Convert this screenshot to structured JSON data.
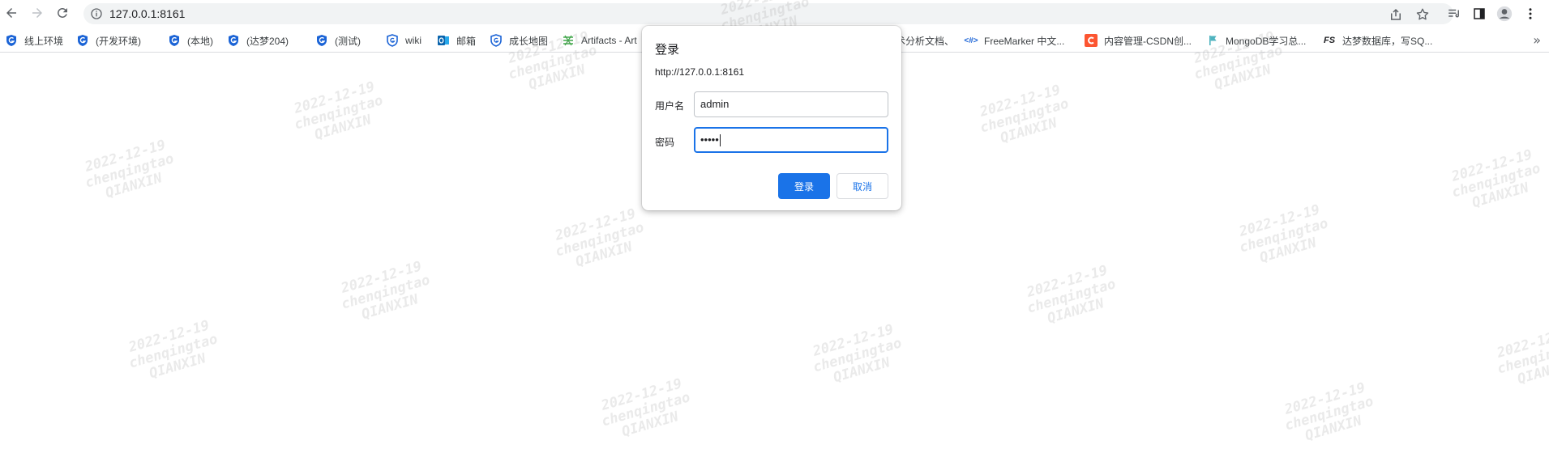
{
  "toolbar": {
    "url": "127.0.0.1:8161"
  },
  "bookmarks": [
    {
      "label": "线上环境",
      "icon": "shield-icon"
    },
    {
      "label": "(开发环境)",
      "icon": "shield-icon"
    },
    {
      "label": "(本地)",
      "icon": "shield-icon"
    },
    {
      "label": "(达梦204)",
      "icon": "shield-icon"
    },
    {
      "label": "(测试)",
      "icon": "shield-icon"
    },
    {
      "label": "wiki",
      "icon": "shield-icon"
    },
    {
      "label": "邮箱",
      "icon": "outlook-icon"
    },
    {
      "label": "成长地图",
      "icon": "shield-icon"
    },
    {
      "label": "Artifacts - Art",
      "icon": "artifacts-icon"
    },
    {
      "label": "术分析文档、",
      "icon": ""
    },
    {
      "label": "FreeMarker 中文...",
      "icon": "code-tag-icon"
    },
    {
      "label": "内容管理-CSDN创...",
      "icon": "csdn-icon"
    },
    {
      "label": "MongoDB学习总...",
      "icon": "flag-icon"
    },
    {
      "label": "达梦数据库，写SQ...",
      "icon": "fs-icon"
    }
  ],
  "dialog": {
    "title": "登录",
    "origin": "http://127.0.0.1:8161",
    "username_label": "用户名",
    "username_value": "admin",
    "password_label": "密码",
    "password_value": "•••••",
    "login_button": "登录",
    "cancel_button": "取消"
  },
  "watermark": {
    "date": "2022-12-19",
    "user": "chenqingtao",
    "org": "QIANXIN"
  },
  "colors": {
    "accent": "#1a73e8",
    "shield_blue": "#1a63d6"
  }
}
